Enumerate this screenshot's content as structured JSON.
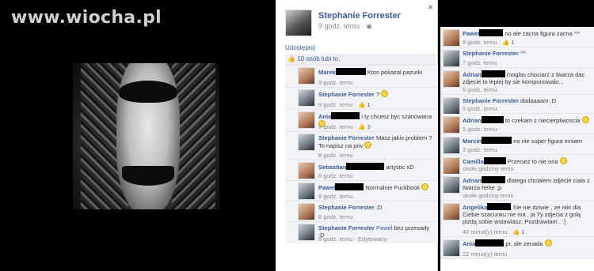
{
  "watermark": "www.wiocha.pl",
  "main": {
    "owner_name": "Stephanie Forrester",
    "owner_time": "9 godz. temu · ",
    "close": "×",
    "share_label": "Udostępnij",
    "likes_label": "10 osób lubi to.",
    "comments": [
      {
        "name": "Marek",
        "text": "Ktos pokazal pazurki",
        "meta": "9 godz. temu",
        "h": 28,
        "blk": 38
      },
      {
        "name": "Stephanie Forrester",
        "text": "?",
        "meta": "9 godz. temu · ",
        "likes": "1",
        "h": 28,
        "smiley": true
      },
      {
        "name": "Ania",
        "text": "i ty chcesz byc szanowana",
        "meta": "8 godz. temu · ",
        "likes": "3",
        "h": 28,
        "blk": 36,
        "smiley": true
      },
      {
        "name": "Stephanie Forrester",
        "text": "Masz jakis problem ? To napisz na priv",
        "meta": "8 godz. temu",
        "h": 36,
        "smiley": true
      },
      {
        "name": "Sebastian",
        "text": "artystic xD",
        "meta": "8 godz. temu",
        "h": 26,
        "blk": 48
      },
      {
        "name": "Paweł",
        "text": "Normalnie Fuckbook",
        "meta": "8 godz. temu",
        "h": 26,
        "blk": 36,
        "smiley": true
      },
      {
        "name": "Stephanie Forrester",
        "text": ";D",
        "meta": "8 godz. temu",
        "h": 26
      },
      {
        "name": "Stephanie Forrester",
        "mention": "Paweł",
        "text": "bez przesady ;D",
        "meta": "8 godz. temu · Edytowany",
        "h": 28
      }
    ]
  },
  "right": {
    "comments": [
      {
        "name": "Paweł",
        "text": "no ale zacna figura zacna ^^",
        "meta": "8 godz. temu · ",
        "likes": "1",
        "h": 26,
        "blk": 30
      },
      {
        "name": "Stephanie Forrester",
        "text": "^^",
        "meta": "7 godz. temu",
        "h": 26
      },
      {
        "name": "Adrian",
        "text": "moglas chociarz z twarza dac zdjecie to lepiej by sie komponowalo...",
        "meta": "6 godz. temu",
        "h": 34,
        "blk": 30
      },
      {
        "name": "Stephanie Forrester",
        "text": "dodaaaam ;D",
        "meta": "5 godz. temu",
        "h": 24
      },
      {
        "name": "Adrian",
        "text": "to czekam z niecierpliwoscia",
        "meta": "5 godz. temu",
        "h": 26,
        "blk": 28,
        "smiley": true
      },
      {
        "name": "Marcin",
        "text": "no nie super figura mniam",
        "meta": "3 godz. temu",
        "h": 26,
        "blk": 38
      },
      {
        "name": "Camilla",
        "text": "Przeciez to nie ona",
        "meta": "około godziny temu",
        "h": 24,
        "blk": 28,
        "smiley": true
      },
      {
        "name": "Adrian",
        "text": "dlatego chcialem zdjecie ciala z twarza hehe ;p",
        "meta": "około godziny temu",
        "h": 34,
        "blk": 30
      },
      {
        "name": "Angelika",
        "text": "Sie nie dziwie , ze nikt dla Ciebie szacunku nie ma , ja Ty zdjecia z golą pizdą sobie wstawiasz. Pozdrawiam . :]",
        "meta": "40 minut(y) temu · ",
        "likes": "1",
        "h": 46,
        "blk": 30
      },
      {
        "name": "Ania",
        "text": "pr. ale zenada",
        "meta": "22 minut(y) temu",
        "h": 28,
        "blk": 36,
        "smiley": true
      }
    ]
  }
}
